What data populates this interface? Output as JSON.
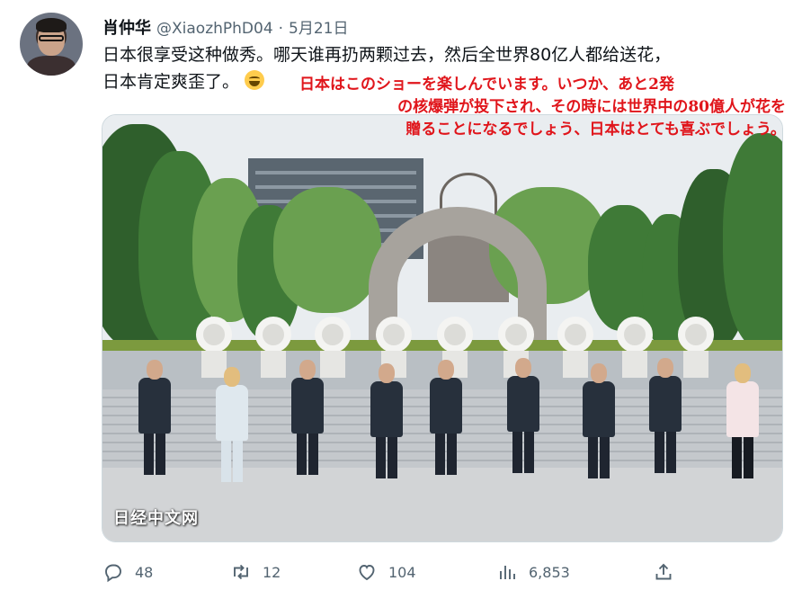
{
  "tweet": {
    "author_name": "肖仲华",
    "author_handle": "@XiaozhPhD04",
    "separator": "·",
    "date": "5月21日",
    "text_line1": "日本很享受这种做秀。哪天谁再扔两颗过去，然后全世界80亿人都给送花，",
    "text_line2": "日本肯定爽歪了。",
    "emoji": "face-with-tears-of-joy-icon"
  },
  "overlay_translation": {
    "line1": "日本はこのショーを楽しんでいます。いつか、あと2発",
    "line2": "の核爆弾が投下され、その時には世界中の80億人が花を",
    "line3": "贈ることになるでしょう、日本はとても喜ぶでしょう。",
    "color": "#e0151b"
  },
  "media": {
    "watermark": "日经中文网",
    "description_icon": "photo"
  },
  "actions": {
    "reply_count": "48",
    "retweet_count": "12",
    "like_count": "104",
    "view_count": "6,853"
  },
  "colors": {
    "text_primary": "#0f1419",
    "text_secondary": "#536471",
    "border": "#cfd9de"
  }
}
